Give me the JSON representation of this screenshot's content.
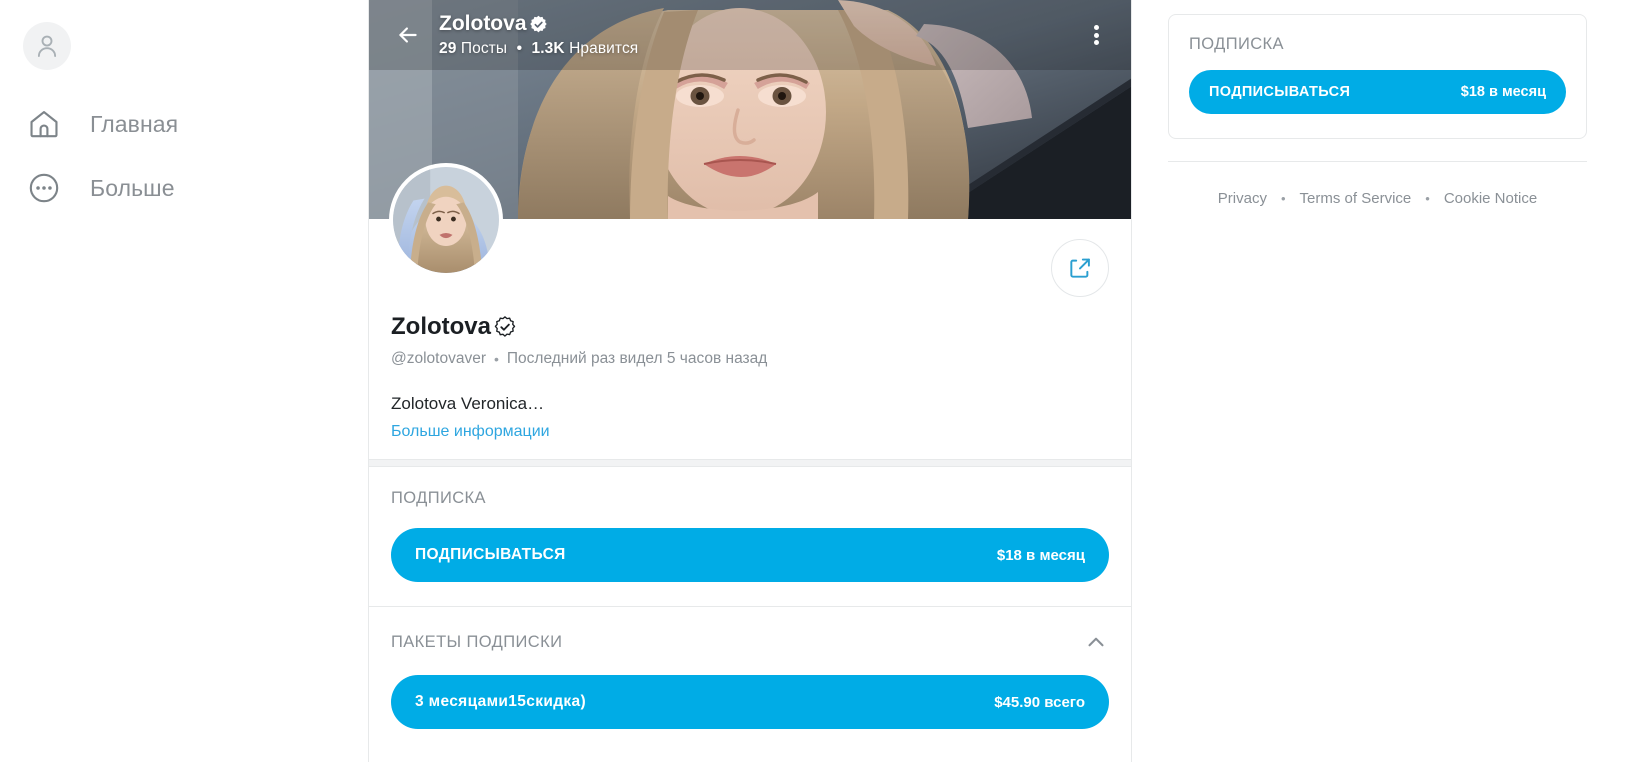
{
  "theme": {
    "accent": "#00ACE6",
    "link": "#2ea6e0",
    "muted": "#8a9096",
    "border": "#e7e9ea"
  },
  "sidebar": {
    "avatar_icon": "person-icon",
    "items": [
      {
        "label": "Главная",
        "icon": "home-icon"
      },
      {
        "label": "Больше",
        "icon": "ellipsis-circle-icon"
      }
    ]
  },
  "cover": {
    "back_icon": "arrow-left-icon",
    "more_icon": "more-vertical-icon",
    "name": "Zolotova",
    "verified_icon": "verified-badge-icon",
    "posts_count": "29",
    "posts_label": "Посты",
    "separator": "•",
    "likes_count": "1.3K",
    "likes_label": "Нравится"
  },
  "profile": {
    "avatar_name": "profile-avatar",
    "share_icon": "share-icon",
    "display_name": "Zolotova",
    "verified_icon": "verified-badge-icon",
    "handle": "@zolotovaver",
    "handle_separator": "•",
    "last_seen": "Последний раз видел 5 часов назад",
    "bio": "Zolotova Veronica…",
    "more_info": "Больше информации"
  },
  "subscription": {
    "title": "ПОДПИСКА",
    "button_label": "ПОДПИСЫВАТЬСЯ",
    "button_price": "$18 в месяц"
  },
  "bundles": {
    "title": "ПАКЕТЫ ПОДПИСКИ",
    "collapse_icon": "chevron-up-icon",
    "items": [
      {
        "label": "3 месяцами15скидка)",
        "price": "$45.90 всего"
      }
    ]
  },
  "right_panel": {
    "card_title": "ПОДПИСКА",
    "button_label": "ПОДПИСЫВАТЬСЯ",
    "button_price": "$18 в месяц",
    "footer": {
      "privacy": "Privacy",
      "sep1": "•",
      "terms": "Terms of Service",
      "sep2": "•",
      "cookie": "Cookie Notice"
    }
  }
}
